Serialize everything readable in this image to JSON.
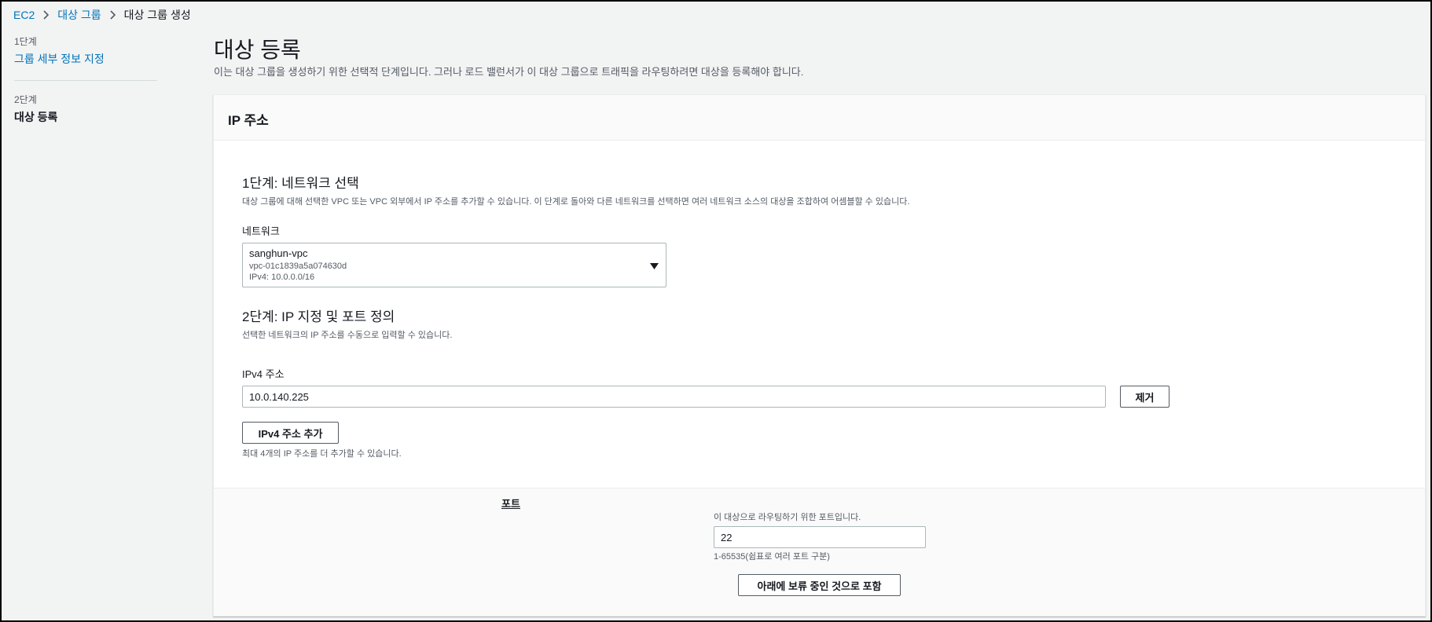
{
  "breadcrumb": {
    "items": [
      "EC2",
      "대상 그룹"
    ],
    "current": "대상 그룹 생성"
  },
  "sidenav": {
    "step1_no": "1단계",
    "step1_label": "그룹 세부 정보 지정",
    "step2_no": "2단계",
    "step2_label": "대상 등록"
  },
  "page": {
    "title": "대상 등록",
    "description": "이는 대상 그룹을 생성하기 위한 선택적 단계입니다. 그러나 로드 밸런서가 이 대상 그룹으로 트래픽을 라우팅하려면 대상을 등록해야 합니다."
  },
  "panel": {
    "header": "IP 주소",
    "step1": {
      "title": "1단계: 네트워크 선택",
      "desc": "대상 그룹에 대해 선택한 VPC 또는 VPC 외부에서 IP 주소를 추가할 수 있습니다. 이 단계로 돌아와 다른 네트워크를 선택하면 여러 네트워크 소스의 대상을 조합하여 어셈블할 수 있습니다.",
      "network_label": "네트워크",
      "network": {
        "name": "sanghun-vpc",
        "id": "vpc-01c1839a5a074630d",
        "cidr": "IPv4: 10.0.0.0/16"
      }
    },
    "step2": {
      "title": "2단계: IP 지정 및 포트 정의",
      "desc": "선택한 네트워크의 IP 주소를 수동으로 입력할 수 있습니다.",
      "ipv4_label": "IPv4 주소",
      "ipv4_value": "10.0.140.225",
      "remove_button": "제거",
      "add_button": "IPv4 주소 추가",
      "add_hint": "최대 4개의 IP 주소를 더 추가할 수 있습니다."
    },
    "port": {
      "label": "포트",
      "desc": "이 대상으로 라우팅하기 위한 포트입니다.",
      "value": "22",
      "hint": "1-65535(쉼표로 여러 포트 구분)",
      "include_button": "아래에 보류 중인 것으로 포함"
    }
  },
  "colors": {
    "link": "#0073bb",
    "background": "#f2f3f3",
    "panel_bg": "#ffffff"
  }
}
